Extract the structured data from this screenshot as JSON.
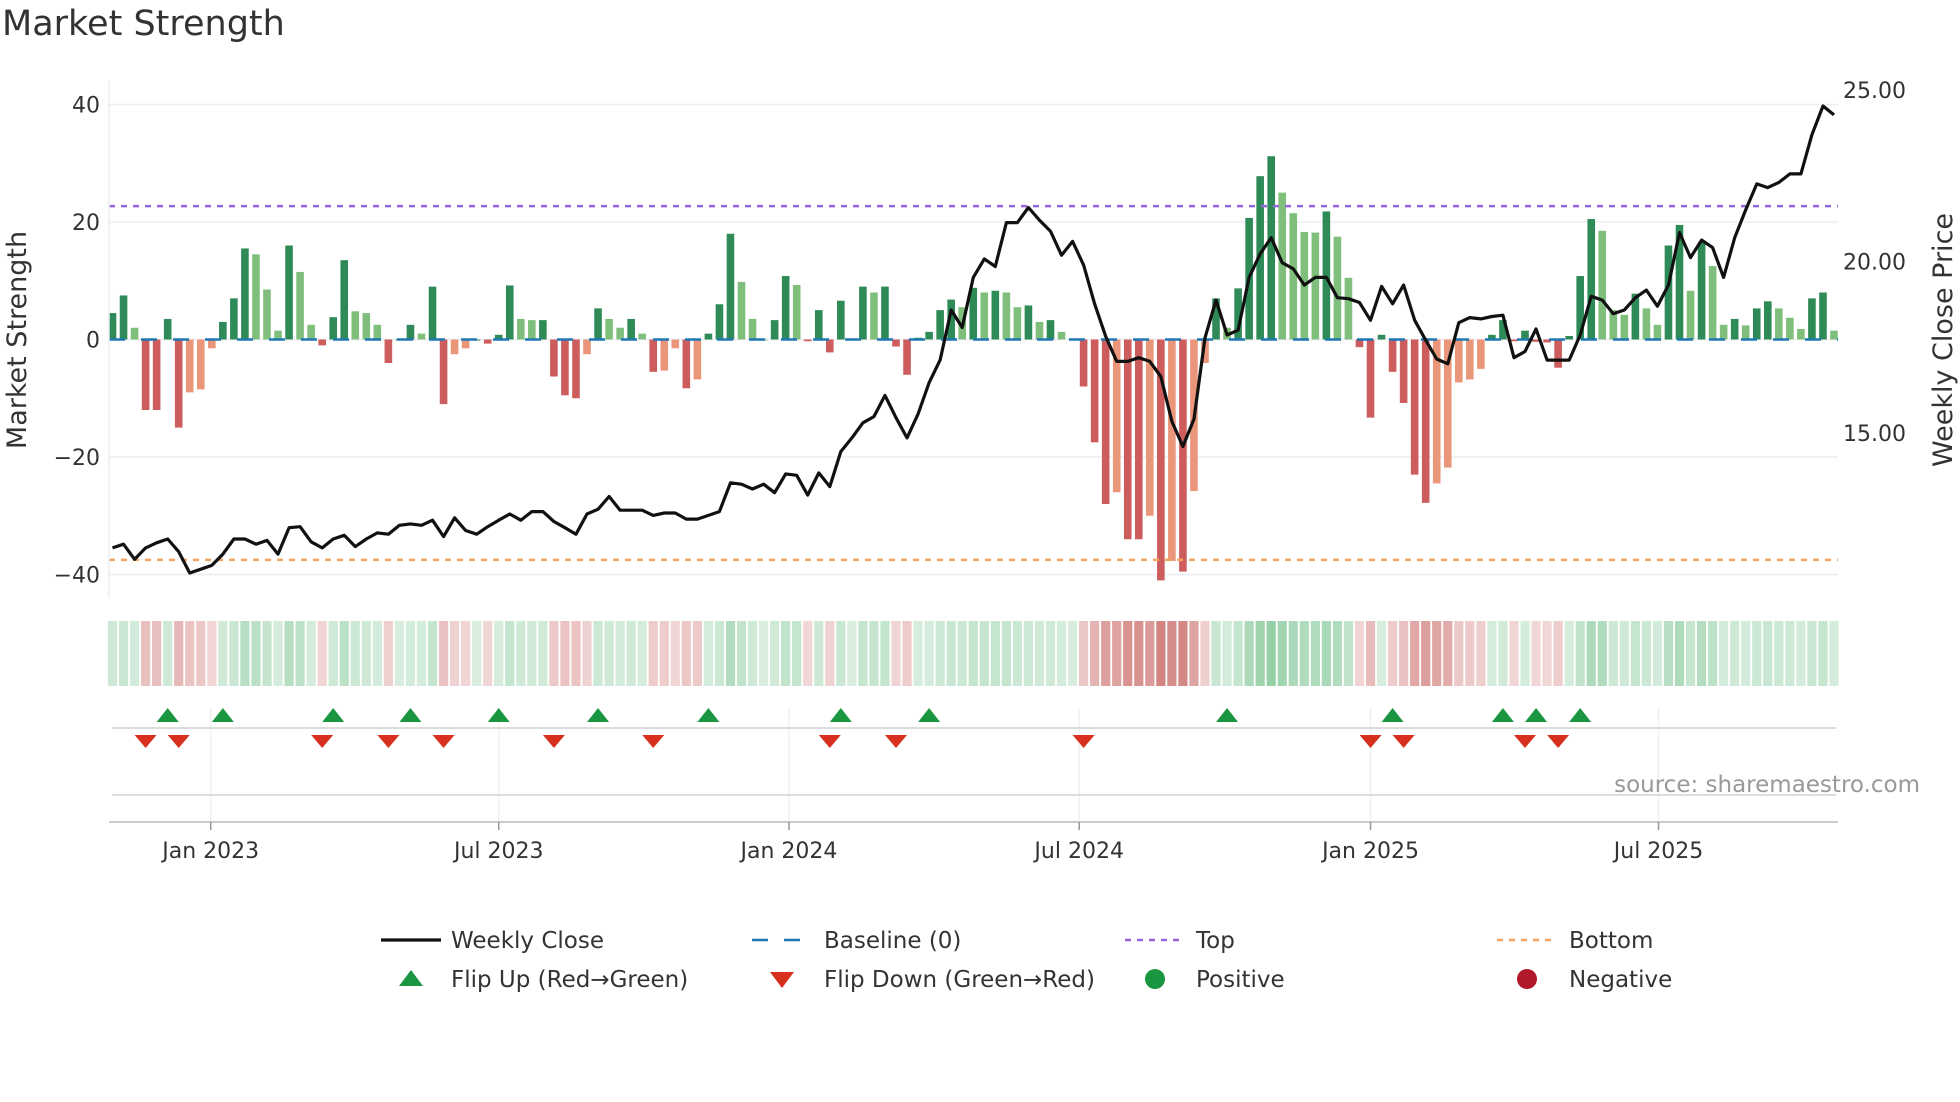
{
  "chart_data": {
    "type": "bar",
    "title": "Market Strength",
    "ylabel": "Market Strength",
    "y2label": "Weekly Close Price",
    "ylim": [
      -44,
      44
    ],
    "y2lim": [
      10.18,
      25.26
    ],
    "yticks": [
      40,
      20,
      0,
      -20,
      -40
    ],
    "ytick_labels": [
      "40",
      "20",
      "0",
      "−20",
      "−40"
    ],
    "y2ticks": [
      25,
      20,
      15
    ],
    "y2tick_labels": [
      "25.00",
      "20.00",
      "15.00"
    ],
    "x_unit": "week index",
    "xticks": [
      {
        "label": "Jan 2023",
        "week": 8.9
      },
      {
        "label": "Jul 2023",
        "week": 35
      },
      {
        "label": "Jan 2024",
        "week": 61.3
      },
      {
        "label": "Jul 2024",
        "week": 87.6
      },
      {
        "label": "Jan 2025",
        "week": 114
      },
      {
        "label": "Jul 2025",
        "week": 140.1
      }
    ],
    "top": 22.7,
    "bottom": -37.5,
    "baseline": 0,
    "strength": [
      4.5,
      7.5,
      2,
      -12,
      -12,
      3.5,
      -15,
      -9,
      -8.5,
      -1.5,
      3,
      7,
      15.5,
      14.5,
      8.5,
      1.5,
      16,
      11.5,
      2.5,
      -1,
      3.8,
      13.5,
      4.8,
      4.5,
      2.5,
      -4,
      0,
      2.5,
      1,
      9,
      -11,
      -2.5,
      -1.5,
      0,
      -0.7,
      0.8,
      9.2,
      3.5,
      3.3,
      3.3,
      -6.3,
      -9.5,
      -10,
      -2.5,
      5.3,
      3.5,
      2,
      3.5,
      1,
      -5.5,
      -5.3,
      -1.5,
      -8.3,
      -6.8,
      1,
      6,
      18,
      9.8,
      3.5,
      0,
      3.3,
      10.8,
      9.3,
      -0.3,
      5,
      -2.2,
      6.6,
      0,
      9,
      8,
      9,
      -1.2,
      -6,
      0.3,
      1.3,
      5,
      6.8,
      5.5,
      8.8,
      8,
      8.3,
      8,
      5.5,
      5.8,
      3,
      3.3,
      1.3,
      0,
      -8,
      -17.5,
      -28,
      -26,
      -34,
      -34,
      -30,
      -41,
      -37.7,
      -39.5,
      -25.8,
      -4,
      7,
      2,
      8.7,
      20.7,
      27.8,
      31.2,
      25,
      21.5,
      18.3,
      18.2,
      21.8,
      17.5,
      10.5,
      -1.3,
      -13.3,
      0.8,
      -5.5,
      -10.8,
      -23,
      -27.8,
      -24.5,
      -21.8,
      -7.3,
      -6.8,
      -5,
      0.8,
      3.3,
      -0.3,
      1.5,
      -0.4,
      -0.5,
      -4.8,
      0.6,
      10.8,
      20.5,
      18.5,
      5,
      4.2,
      7.8,
      5.3,
      2.5,
      16,
      19.5,
      8.3,
      16.5,
      12.5,
      2.5,
      3.5,
      2.4,
      5.3,
      6.5,
      5.3,
      3.7,
      1.8,
      7,
      8,
      1.5
    ],
    "weekly_close": [
      11.64,
      11.75,
      11.31,
      11.64,
      11.79,
      11.9,
      11.53,
      10.91,
      11.02,
      11.13,
      11.46,
      11.9,
      11.9,
      11.75,
      11.86,
      11.46,
      12.23,
      12.26,
      11.82,
      11.64,
      11.9,
      12.01,
      11.68,
      11.9,
      12.08,
      12.04,
      12.3,
      12.34,
      12.3,
      12.45,
      11.97,
      12.52,
      12.15,
      12.04,
      12.26,
      12.45,
      12.63,
      12.45,
      12.7,
      12.7,
      12.41,
      12.23,
      12.04,
      12.63,
      12.77,
      13.14,
      12.74,
      12.74,
      12.74,
      12.59,
      12.66,
      12.66,
      12.48,
      12.48,
      12.59,
      12.7,
      13.54,
      13.5,
      13.36,
      13.5,
      13.25,
      13.8,
      13.76,
      13.18,
      13.83,
      13.43,
      14.45,
      14.85,
      15.29,
      15.47,
      16.09,
      15.44,
      14.85,
      15.55,
      16.46,
      17.12,
      18.58,
      18.07,
      19.53,
      20.07,
      19.85,
      21.13,
      21.13,
      21.57,
      21.2,
      20.88,
      20.18,
      20.58,
      19.89,
      18.76,
      17.81,
      17.08,
      17.08,
      17.19,
      17.08,
      16.64,
      15.33,
      14.6,
      15.4,
      17.77,
      18.87,
      17.85,
      17.99,
      19.53,
      20.22,
      20.69,
      19.96,
      19.78,
      19.31,
      19.53,
      19.53,
      18.94,
      18.91,
      18.8,
      18.28,
      19.27,
      18.76,
      19.31,
      18.28,
      17.7,
      17.15,
      17.01,
      18.21,
      18.36,
      18.32,
      18.39,
      18.43,
      17.19,
      17.37,
      18.03,
      17.12,
      17.12,
      17.12,
      17.85,
      18.98,
      18.87,
      18.47,
      18.58,
      18.94,
      19.16,
      18.69,
      19.31,
      20.84,
      20.11,
      20.62,
      20.4,
      19.53,
      20.69,
      21.5,
      22.26,
      22.15,
      22.3,
      22.55,
      22.55,
      23.69,
      24.53,
      24.27
    ],
    "flip_up_weeks": [
      5,
      10,
      20,
      27,
      35,
      44,
      54,
      66,
      74,
      101,
      116,
      126,
      129,
      133
    ],
    "flip_down_weeks": [
      3,
      6,
      19,
      25,
      30,
      40,
      49,
      65,
      71,
      88,
      114,
      117,
      128,
      131
    ],
    "legend": {
      "placement": "bottom",
      "entries": [
        "Weekly Close",
        "Baseline (0)",
        "Top",
        "Bottom",
        "Flip Up (Red→Green)",
        "Flip Down (Green→Red)",
        "Positive",
        "Negative"
      ]
    },
    "source": "source: sharemaestro.com"
  },
  "colors": {
    "pos_strong": "#2e8b57",
    "pos_weak": "#7fbf7b",
    "neg_strong": "#cd5c5c",
    "neg_weak": "#e9967a",
    "baseline": "#1f77b4",
    "top": "#9467dd",
    "bottom": "#f4a460",
    "close": "#111111",
    "flip_up": "#1a9641",
    "flip_down": "#d7301f",
    "positive": "#1a9641",
    "negative": "#b2182b"
  }
}
